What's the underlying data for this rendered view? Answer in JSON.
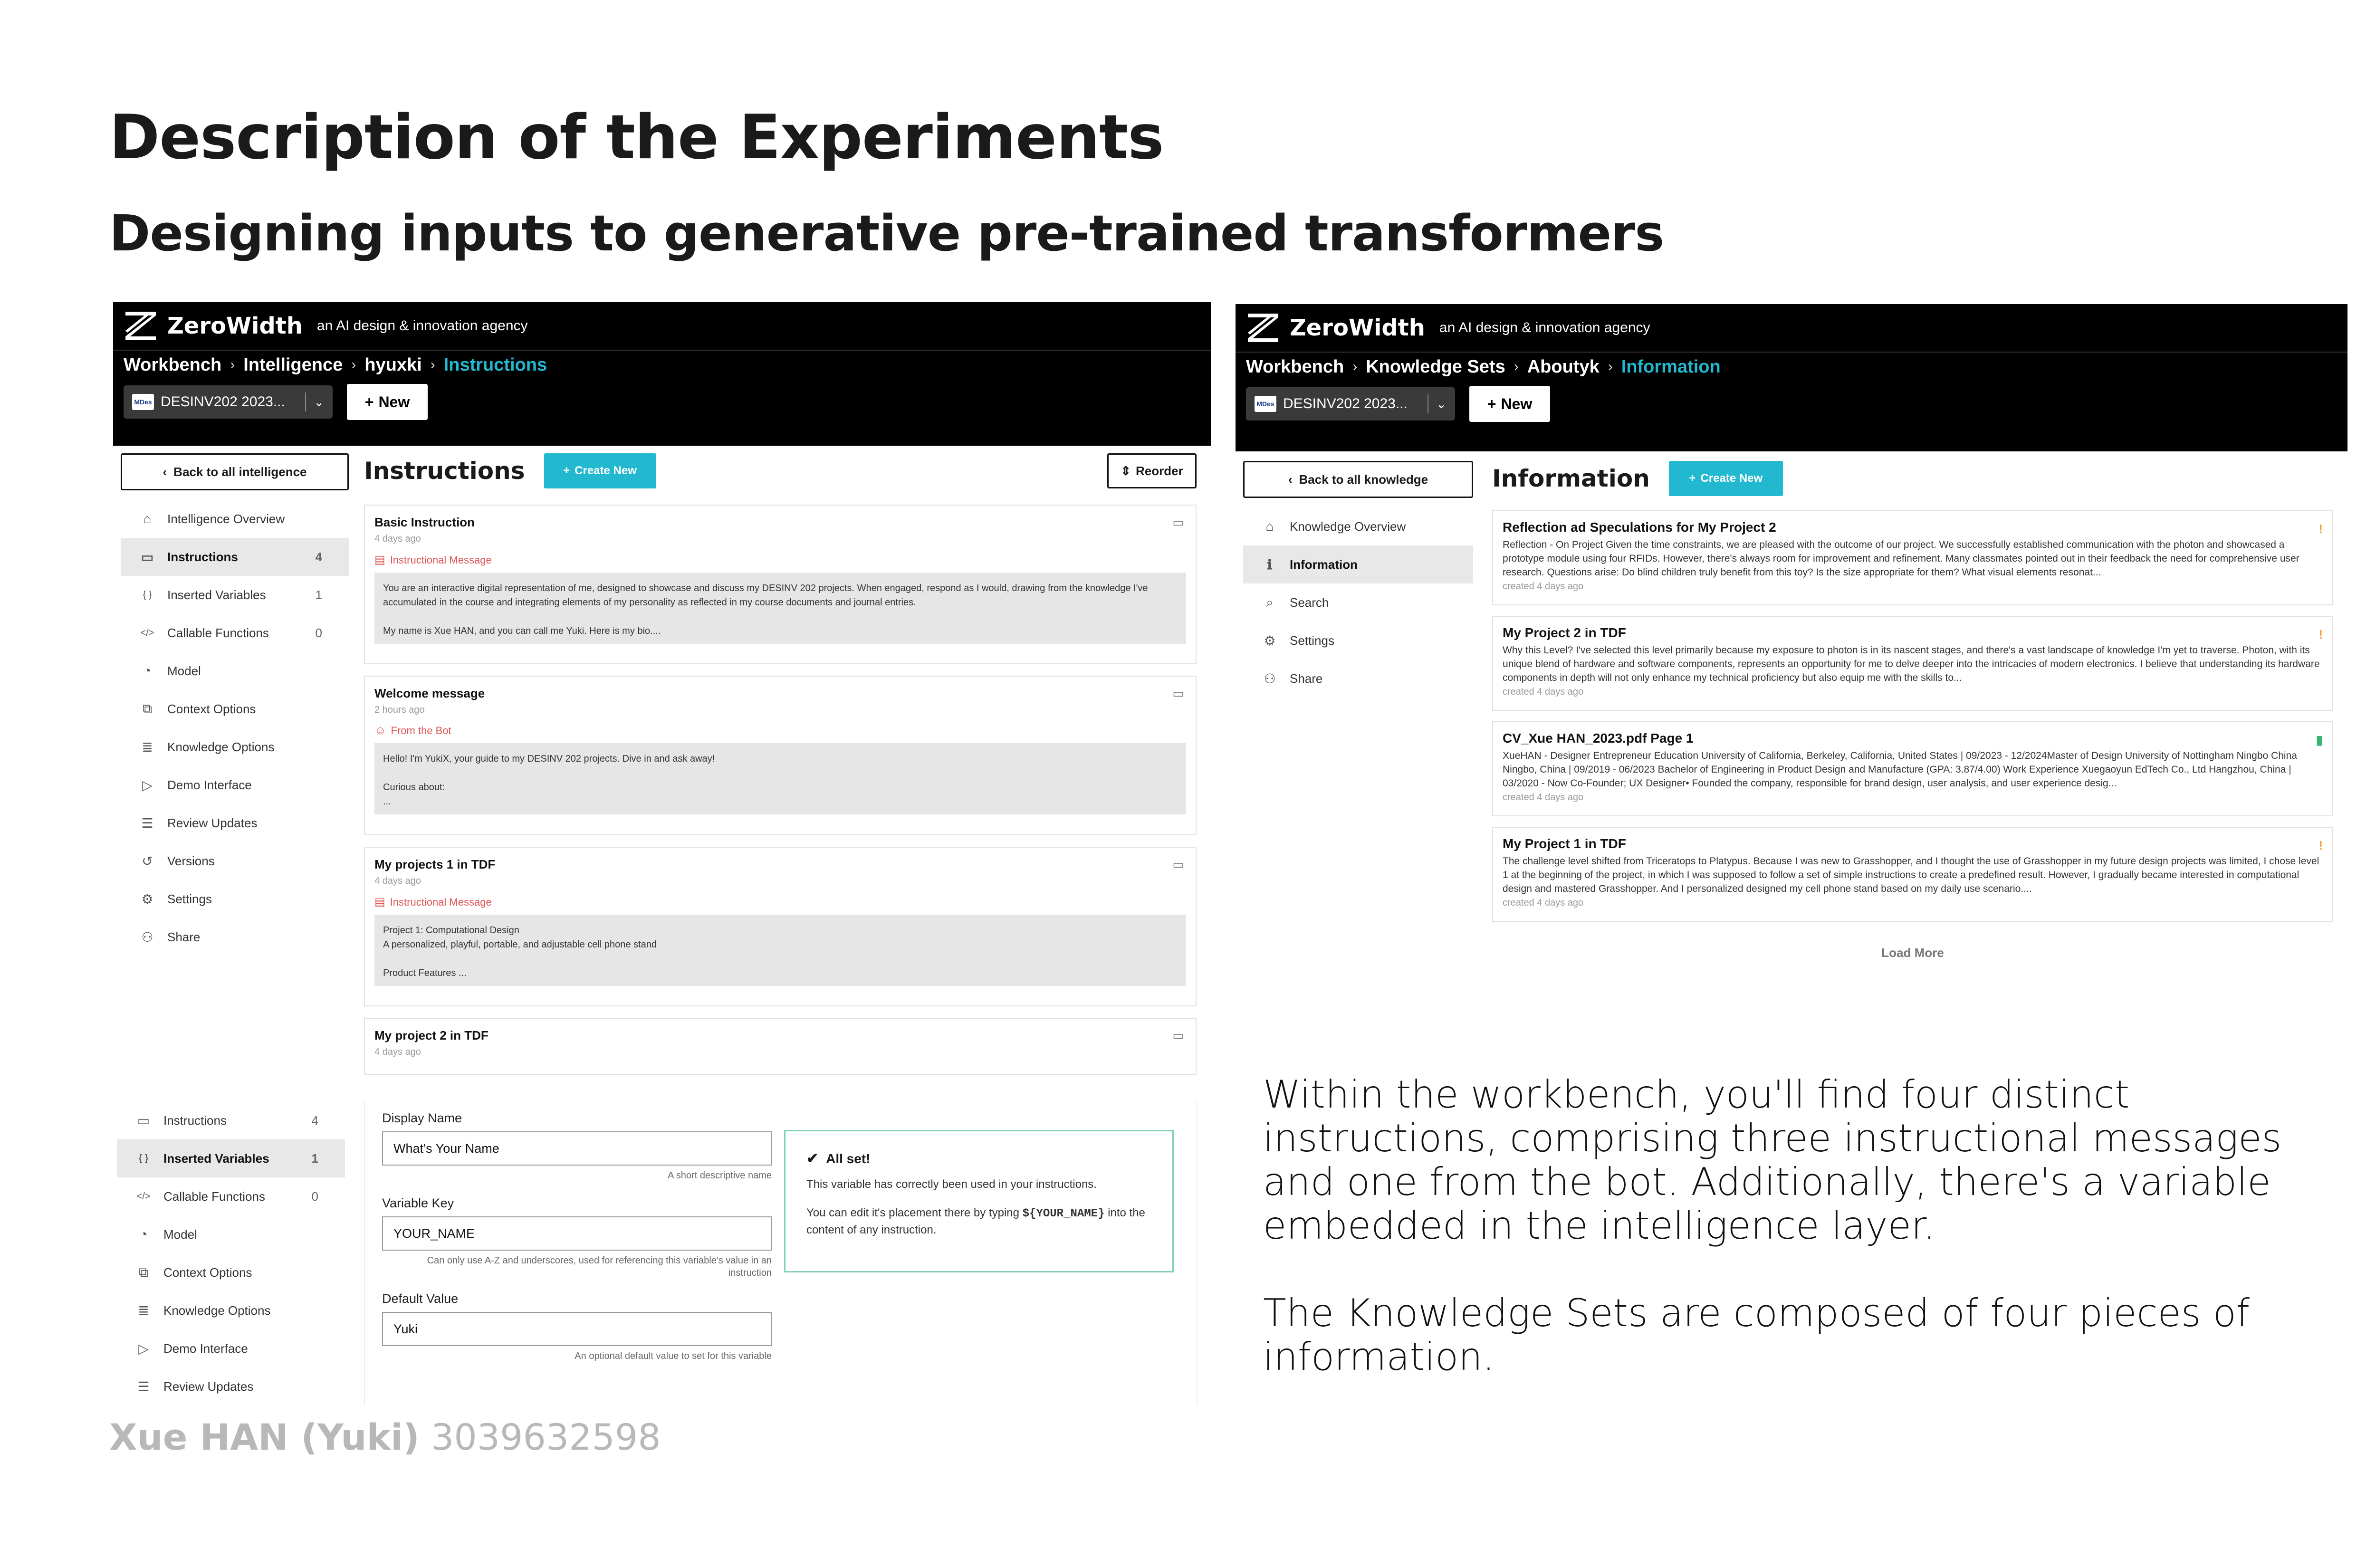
{
  "slide": {
    "title": "Description of the Experiments",
    "subtitle": "Designing inputs to generative pre-trained transformers",
    "author_name": "Xue HAN (Yuki)",
    "author_id": "3039632598",
    "description_1": "Within the workbench, you'll find four distinct instructions, comprising three instructional messages and one from the bot. Additionally, there's a variable embedded in the intelligence layer.",
    "description_2": "The Knowledge Sets are composed of four pieces of information."
  },
  "brand": {
    "name": "ZeroWidth",
    "tagline": "an AI design & innovation agency"
  },
  "left_app": {
    "breadcrumb": [
      "Workbench",
      "Intelligence",
      "hyuxki",
      "Instructions"
    ],
    "project_select": "DESINV202 2023...",
    "project_icon_text": "MDes",
    "new_label": "New",
    "back_label": "Back to all intelligence",
    "page_title": "Instructions",
    "create_label": "Create New",
    "reorder_label": "Reorder",
    "sidebar": [
      {
        "label": "Intelligence Overview",
        "icon": "home-icon",
        "count": ""
      },
      {
        "label": "Instructions",
        "icon": "message-icon",
        "count": "4"
      },
      {
        "label": "Inserted Variables",
        "icon": "braces-icon",
        "count": "1"
      },
      {
        "label": "Callable Functions",
        "icon": "code-icon",
        "count": "0"
      },
      {
        "label": "Model",
        "icon": "brain-icon",
        "count": ""
      },
      {
        "label": "Context Options",
        "icon": "context-icon",
        "count": ""
      },
      {
        "label": "Knowledge Options",
        "icon": "database-icon",
        "count": ""
      },
      {
        "label": "Demo Interface",
        "icon": "play-icon",
        "count": ""
      },
      {
        "label": "Review Updates",
        "icon": "list-icon",
        "count": ""
      },
      {
        "label": "Versions",
        "icon": "history-icon",
        "count": ""
      },
      {
        "label": "Settings",
        "icon": "gear-icon",
        "count": ""
      },
      {
        "label": "Share",
        "icon": "users-icon",
        "count": ""
      }
    ],
    "cards": [
      {
        "title": "Basic Instruction",
        "time": "4 days ago",
        "type": "Instructional Message",
        "body": "You are an interactive digital representation of me, designed to showcase and discuss my DESINV 202 projects. When engaged, respond as I would, drawing from the knowledge I've accumulated in the course and integrating elements of my personality as reflected in my course documents and journal entries.\n\nMy name is Xue HAN, and you can call me Yuki. Here is my bio...."
      },
      {
        "title": "Welcome message",
        "time": "2 hours ago",
        "type": "From the Bot",
        "body": "Hello! I'm YukiX, your guide to my DESINV 202 projects. Dive in and ask away!\n\nCurious about:\n..."
      },
      {
        "title": "My projects 1 in TDF",
        "time": "4 days ago",
        "type": "Instructional Message",
        "body": "Project 1: Computational Design\nA personalized, playful, portable, and adjustable cell phone stand\n\nProduct Features ..."
      },
      {
        "title": "My project 2 in TDF",
        "time": "4 days ago",
        "type": "",
        "body": ""
      }
    ]
  },
  "right_app": {
    "breadcrumb": [
      "Workbench",
      "Knowledge Sets",
      "Aboutyk",
      "Information"
    ],
    "project_select": "DESINV202 2023...",
    "project_icon_text": "MDes",
    "new_label": "New",
    "back_label": "Back to all knowledge",
    "page_title": "Information",
    "create_label": "Create New",
    "load_more": "Load More",
    "sidebar": [
      {
        "label": "Knowledge Overview",
        "icon": "home-icon"
      },
      {
        "label": "Information",
        "icon": "info-icon"
      },
      {
        "label": "Search",
        "icon": "search-icon"
      },
      {
        "label": "Settings",
        "icon": "gear-icon"
      },
      {
        "label": "Share",
        "icon": "users-icon"
      }
    ],
    "items": [
      {
        "title": "Reflection ad Speculations for My Project 2",
        "desc": "Reflection - On Project Given the time constraints, we are pleased with the outcome of our project. We successfully established communication with the photon and showcased a prototype module using four RFIDs. However, there's always room for improvement and refinement. Many classmates pointed out in their feedback the need for comprehensive user research. Questions arise: Do blind children truly benefit from this toy? Is the size appropriate for them? What visual elements resonat...",
        "time": "created 4 days ago",
        "flag": "!",
        "flag_color": "#f0a030"
      },
      {
        "title": "My Project 2 in TDF",
        "desc": "Why this Level? I've selected this level primarily because my exposure to photon is in its nascent stages, and there's a vast landscape of knowledge I'm yet to traverse. Photon, with its unique blend of hardware and software components, represents an opportunity for me to delve deeper into the intricacies of modern electronics. I believe that understanding its hardware components in depth will not only enhance my technical proficiency but also equip me with the skills to...",
        "time": "created 4 days ago",
        "flag": "!",
        "flag_color": "#f0a030"
      },
      {
        "title": "CV_Xue HAN_2023.pdf Page 1",
        "desc": "XueHAN - Designer Entrepreneur Education University of California, Berkeley, California, United States | 09/2023 - 12/2024Master of Design University of Nottingham Ningbo China Ningbo, China | 09/2019 - 06/2023 Bachelor of Engineering in Product Design and Manufacture (GPA: 3.87/4.00) Work Experience Xuegaoyun EdTech Co., Ltd Hangzhou, China | 03/2020 - Now Co-Founder; UX Designer• Founded the company, responsible for brand design, user analysis, and user experience desig...",
        "time": "created 4 days ago",
        "flag": "▮",
        "flag_color": "#3cb371"
      },
      {
        "title": "My Project 1 in TDF",
        "desc": "The challenge level shifted from Triceratops to Platypus. Because I was new to Grasshopper, and I thought the use of Grasshopper in my future design projects was limited, I chose level 1 at the beginning of the project, in which I was supposed to follow a set of simple instructions to create a predefined result. However, I gradually became interested in computational design and mastered Grasshopper. And I personalized designed my cell phone stand based on my daily use scenario....",
        "time": "created 4 days ago",
        "flag": "!",
        "flag_color": "#f0a030"
      }
    ]
  },
  "variables_panel": {
    "sidebar": [
      {
        "label": "Instructions",
        "icon": "message-icon",
        "count": "4"
      },
      {
        "label": "Inserted Variables",
        "icon": "braces-icon",
        "count": "1"
      },
      {
        "label": "Callable Functions",
        "icon": "code-icon",
        "count": "0"
      },
      {
        "label": "Model",
        "icon": "brain-icon",
        "count": ""
      },
      {
        "label": "Context Options",
        "icon": "context-icon",
        "count": ""
      },
      {
        "label": "Knowledge Options",
        "icon": "database-icon",
        "count": ""
      },
      {
        "label": "Demo Interface",
        "icon": "play-icon",
        "count": ""
      },
      {
        "label": "Review Updates",
        "icon": "list-icon",
        "count": ""
      }
    ],
    "display_name_label": "Display Name",
    "display_name_value": "What's Your Name",
    "display_name_hint": "A short descriptive name",
    "variable_key_label": "Variable Key",
    "variable_key_value": "YOUR_NAME",
    "variable_key_hint": "Can only use A-Z and underscores, used for referencing this variable's value in an instruction",
    "default_value_label": "Default Value",
    "default_value_value": "Yuki",
    "default_value_hint": "An optional default value to set for this variable",
    "allset_title": "All set!",
    "allset_text_1": "This variable has correctly been used in your instructions.",
    "allset_text_2a": "You can edit it's placement there by typing",
    "allset_code": "${YOUR_NAME}",
    "allset_text_2b": "into the content of any instruction."
  }
}
